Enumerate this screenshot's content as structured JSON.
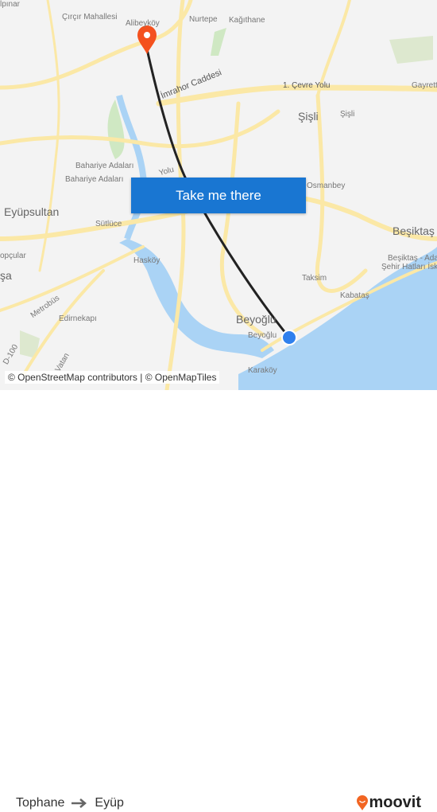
{
  "map": {
    "labels": {
      "alibeykoy": "Alibeyköy",
      "cirçir": "Çırçır Mahallesi",
      "nurtepe": "Nurtepe",
      "kagithane": "Kağıthane",
      "alpinar": "lpınar",
      "cevre_yolu": "1. Çevre Yolu",
      "gayrettepe": "Gayrett",
      "imrahor": "İmrahor Caddesi",
      "sisli_big": "Şişli",
      "sisli_small": "Şişli",
      "baharive1": "Bahariye Adaları",
      "baharive2": "Bahariye Adaları",
      "eyupsultan": "Eyüpsultan",
      "sutluce": "Sütlüce",
      "yolu": "Yolu",
      "osmanbey": "Osmanbey",
      "besiktas": "Beşiktaş",
      "besiktas_ferry": "Beşiktaş - Adalar",
      "sehir_hatlari": "Şehir Hatları İske",
      "topcular": "opçular",
      "pasa": "şa",
      "haskoy": "Hasköy",
      "taksim": "Taksim",
      "kabatas": "Kabataş",
      "metrobus": "Metrobüs",
      "edirnekapi": "Edirnekapı",
      "beyoglu_big": "Beyoğlu",
      "beyoglu_small": "Beyoğlu",
      "karakoy": "Karaköy",
      "d100": "D-100",
      "vatan": "Vatan"
    },
    "cta_label": "Take me there",
    "attribution": "© OpenStreetMap contributors | © OpenMapTiles",
    "origin_marker_color": "#2f80ed",
    "destination_marker_color": "#f4511e",
    "route_color": "#222222",
    "water_color": "#aad3f5",
    "road_color": "#fbe8a6",
    "park_color": "#cfe8c3"
  },
  "footer": {
    "origin": "Tophane",
    "arrow_icon": "arrow-right-icon",
    "destination": "Eyüp",
    "brand": "moovit",
    "brand_color": "#f26522"
  }
}
